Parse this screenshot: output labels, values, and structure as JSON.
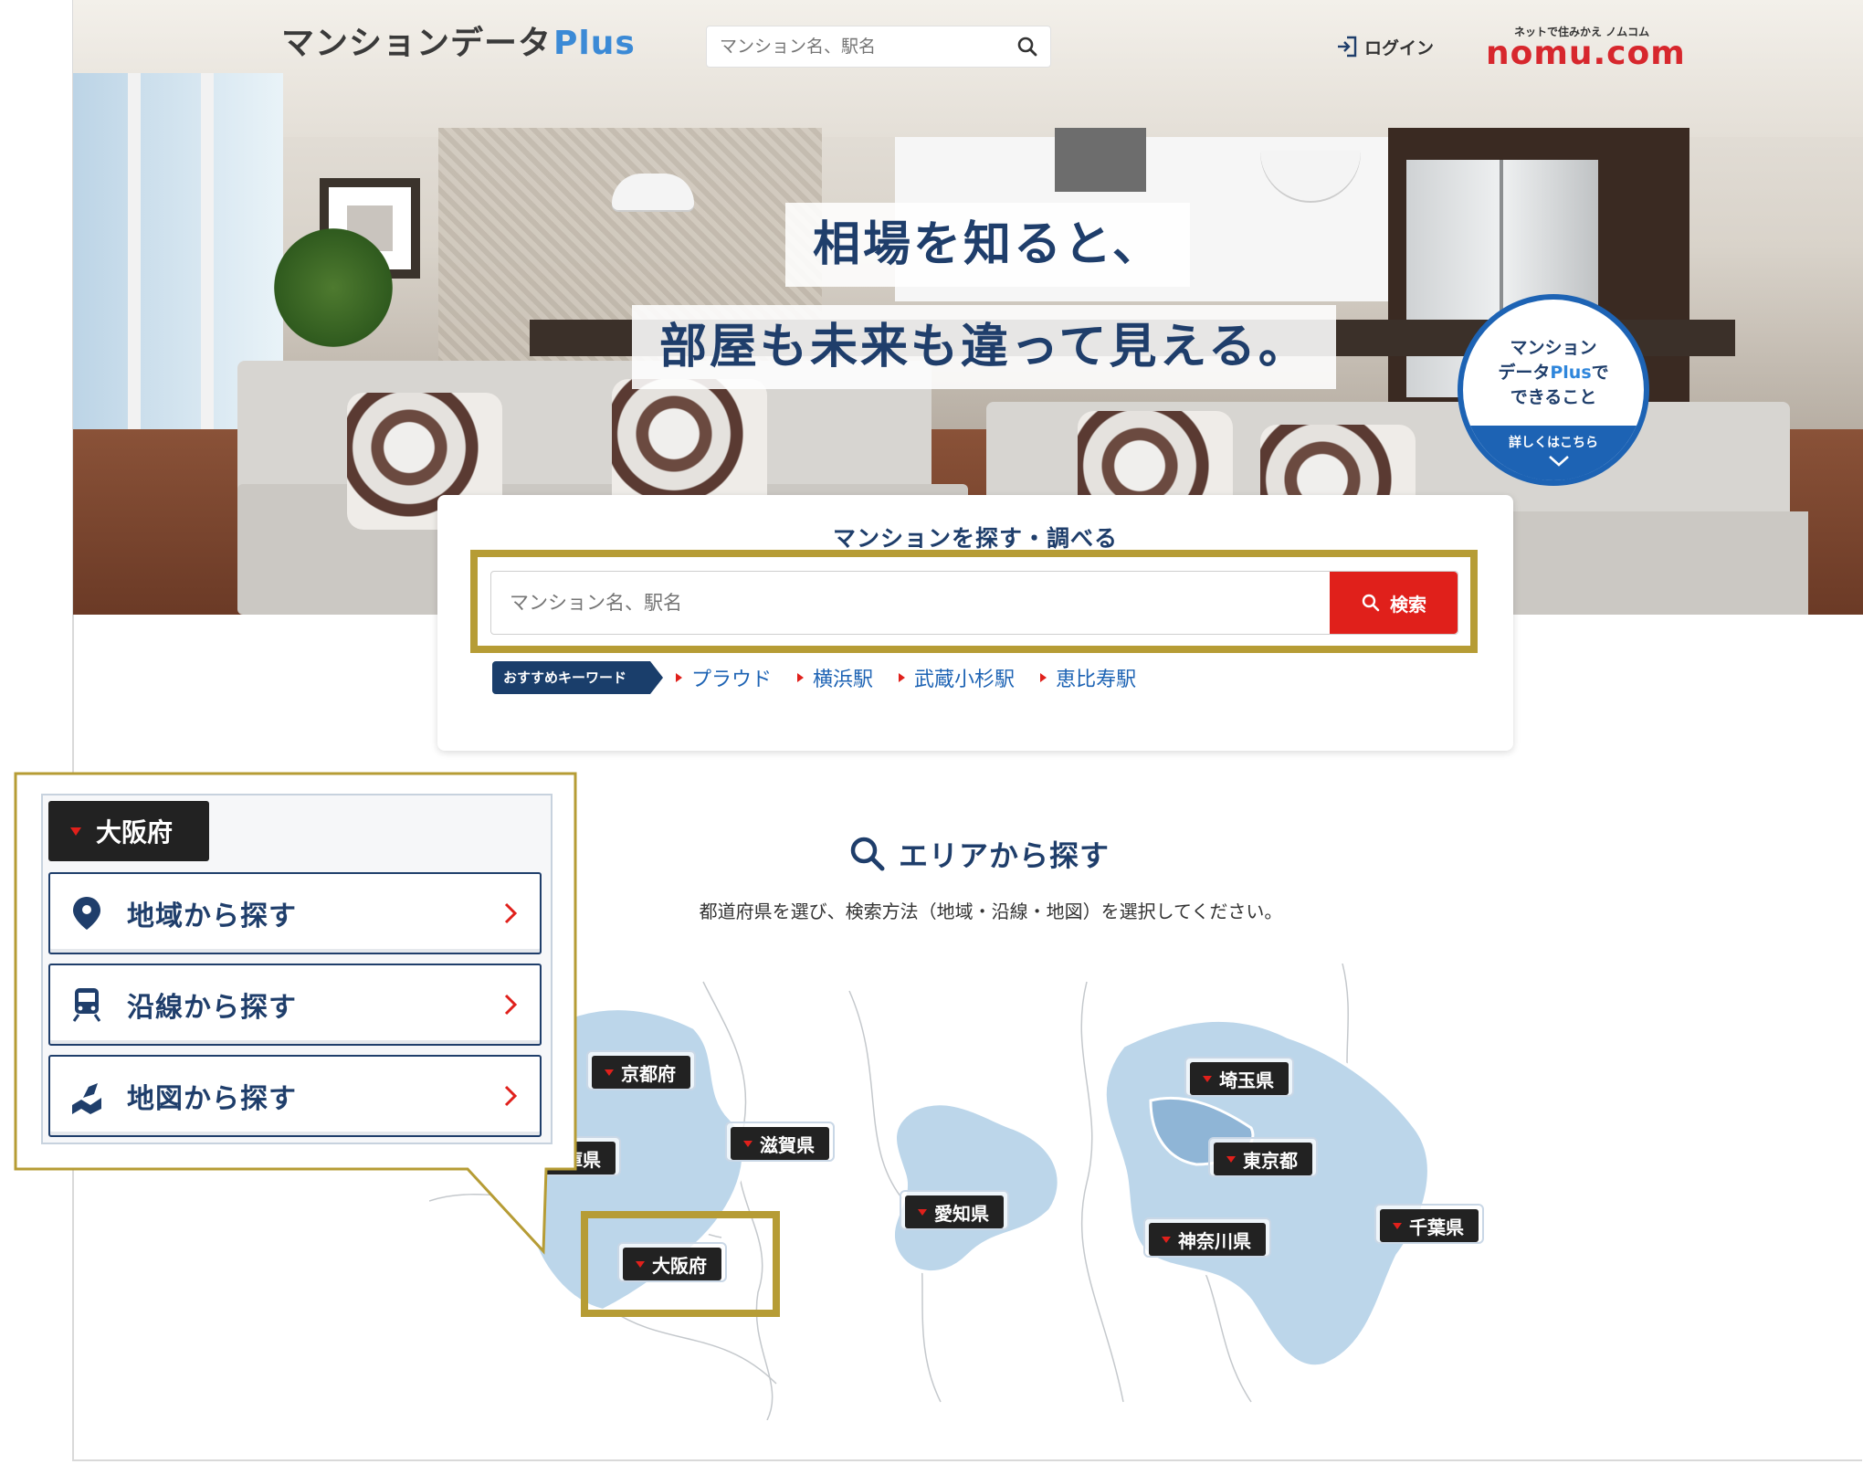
{
  "header": {
    "logo_text": "マンションデータ",
    "logo_plus": "Plus",
    "search_placeholder": "マンション名、駅名",
    "login_label": "ログイン",
    "nomu_subtitle": "ネットで住みかえ ノムコム",
    "nomu_logo": "nomu.com"
  },
  "hero": {
    "tagline_line1": "相場を知ると、",
    "tagline_line2": "部屋も未来も違って見える。",
    "badge": {
      "line1": "マンション",
      "line2_pre": "データ",
      "line2_plus": "Plus",
      "line2_post": "で",
      "line3": "できること",
      "link": "詳しくはこちら"
    }
  },
  "search_panel": {
    "title": "マンションを探す・調べる",
    "placeholder": "マンション名、駅名",
    "button_label": "検索",
    "keyword_tag": "おすすめキーワード",
    "keywords": [
      "プラウド",
      "横浜駅",
      "武蔵小杉駅",
      "恵比寿駅"
    ]
  },
  "area": {
    "title": "エリアから探す",
    "description": "都道府県を選び、検索方法（地域・沿線・地図）を選択してください。",
    "prefectures": {
      "kyoto": "京都府",
      "hyogo": "兵庫県",
      "shiga": "滋賀県",
      "osaka": "大阪府",
      "aichi": "愛知県",
      "saitama": "埼玉県",
      "tokyo": "東京都",
      "kanagawa": "神奈川県",
      "chiba": "千葉県"
    }
  },
  "callout": {
    "selected_pref": "大阪府",
    "options": [
      {
        "label": "地域から探す",
        "icon": "map-pin-icon"
      },
      {
        "label": "沿線から探す",
        "icon": "train-icon"
      },
      {
        "label": "地図から探す",
        "icon": "folded-map-icon"
      }
    ]
  },
  "colors": {
    "navy": "#1f3e6b",
    "brand_blue": "#1d63b4",
    "red": "#e0201b",
    "highlight_gold": "#b69c35",
    "map_fill": "#bcd6ea"
  }
}
